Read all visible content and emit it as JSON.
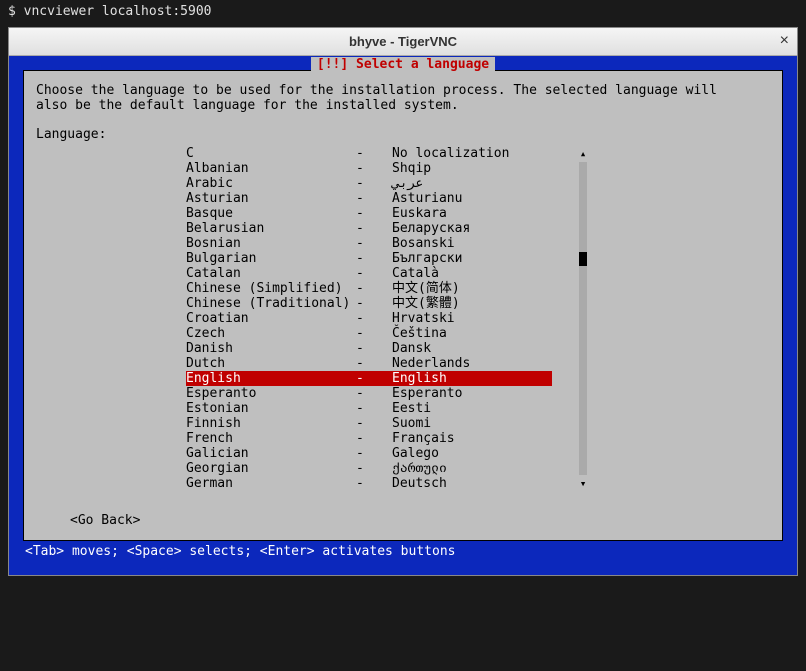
{
  "terminal": {
    "prompt": "$ vncviewer localhost:5900"
  },
  "window": {
    "title": "bhyve - TigerVNC"
  },
  "dialog": {
    "title": "[!!] Select a language",
    "instructions": "Choose the language to be used for the installation process. The selected language will\nalso be the default language for the installed system.",
    "label": "Language:",
    "go_back": "<Go Back>"
  },
  "languages": [
    {
      "name": "C",
      "native": "No localization",
      "selected": false
    },
    {
      "name": "Albanian",
      "native": "Shqip",
      "selected": false
    },
    {
      "name": "Arabic",
      "native": "عربي",
      "selected": false
    },
    {
      "name": "Asturian",
      "native": "Asturianu",
      "selected": false
    },
    {
      "name": "Basque",
      "native": "Euskara",
      "selected": false
    },
    {
      "name": "Belarusian",
      "native": "Беларуская",
      "selected": false
    },
    {
      "name": "Bosnian",
      "native": "Bosanski",
      "selected": false
    },
    {
      "name": "Bulgarian",
      "native": "Български",
      "selected": false
    },
    {
      "name": "Catalan",
      "native": "Català",
      "selected": false
    },
    {
      "name": "Chinese (Simplified)",
      "native": "中文(简体)",
      "selected": false
    },
    {
      "name": "Chinese (Traditional)",
      "native": "中文(繁體)",
      "selected": false
    },
    {
      "name": "Croatian",
      "native": "Hrvatski",
      "selected": false
    },
    {
      "name": "Czech",
      "native": "Čeština",
      "selected": false
    },
    {
      "name": "Danish",
      "native": "Dansk",
      "selected": false
    },
    {
      "name": "Dutch",
      "native": "Nederlands",
      "selected": false
    },
    {
      "name": "English",
      "native": "English",
      "selected": true
    },
    {
      "name": "Esperanto",
      "native": "Esperanto",
      "selected": false
    },
    {
      "name": "Estonian",
      "native": "Eesti",
      "selected": false
    },
    {
      "name": "Finnish",
      "native": "Suomi",
      "selected": false
    },
    {
      "name": "French",
      "native": "Français",
      "selected": false
    },
    {
      "name": "Galician",
      "native": "Galego",
      "selected": false
    },
    {
      "name": "Georgian",
      "native": "ქართული",
      "selected": false
    },
    {
      "name": "German",
      "native": "Deutsch",
      "selected": false
    }
  ],
  "footer": "<Tab> moves; <Space> selects; <Enter> activates buttons"
}
